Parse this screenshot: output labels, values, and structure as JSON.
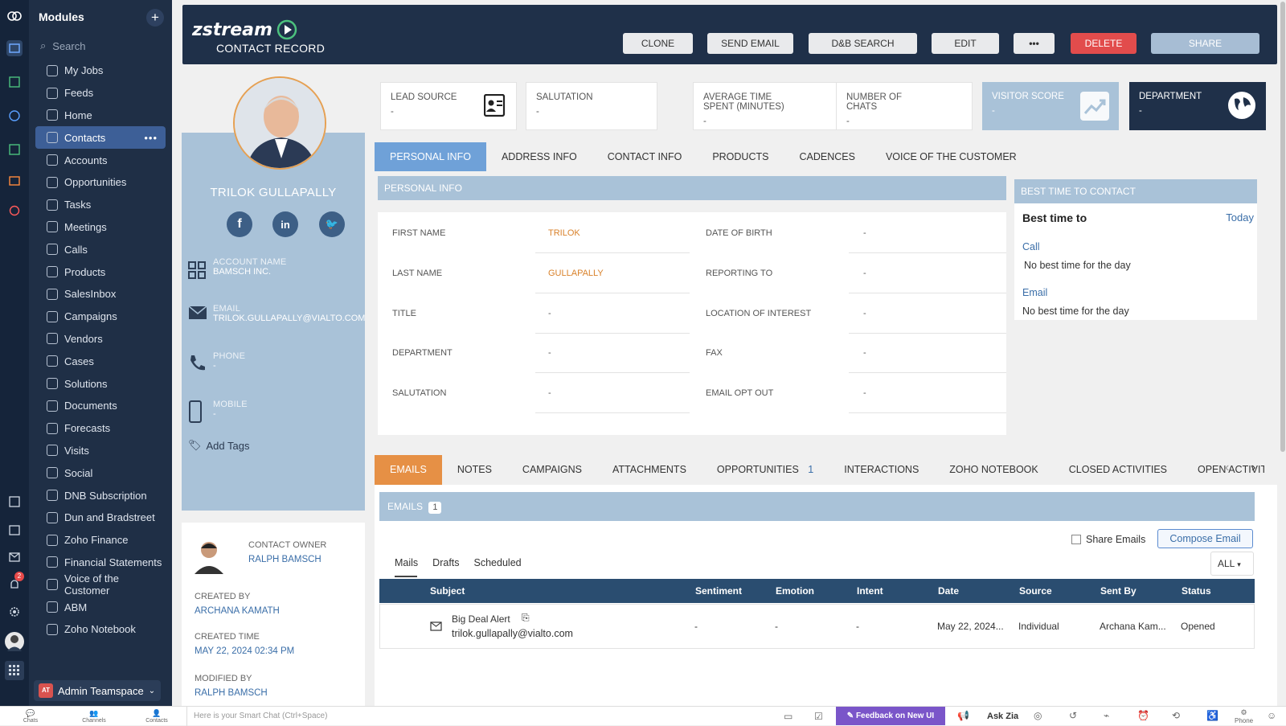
{
  "sidebar": {
    "title": "Modules",
    "add": "+",
    "search_placeholder": "Search",
    "items": [
      "My Jobs",
      "Feeds",
      "Home",
      "Contacts",
      "Accounts",
      "Opportunities",
      "Tasks",
      "Meetings",
      "Calls",
      "Products",
      "SalesInbox",
      "Campaigns",
      "Vendors",
      "Cases",
      "Solutions",
      "Documents",
      "Forecasts",
      "Visits",
      "Social",
      "DNB Subscription",
      "Dun and Bradstreet",
      "Zoho Finance",
      "Financial Statements",
      "Voice of the Customer",
      "ABM",
      "Zoho Notebook"
    ],
    "active": "Contacts",
    "more": "•••",
    "team_initials": "AT",
    "team": "Admin Teamspace",
    "notif_count": "2"
  },
  "header": {
    "logo": "zstream",
    "subtitle": "CONTACT RECORD",
    "buttons": {
      "clone": "CLONE",
      "send_email": "SEND EMAIL",
      "db_search": "D&B SEARCH",
      "edit": "EDIT",
      "more": "•••",
      "delete": "DELETE",
      "share": "SHARE"
    }
  },
  "contact": {
    "name": "TRILOK GULLAPALLY",
    "account_label": "ACCOUNT NAME",
    "account": "BAMSCH INC.",
    "email_label": "EMAIL",
    "email": "TRILOK.GULLAPALLY@VIALTO.COM",
    "phone_label": "PHONE",
    "phone": "-",
    "mobile_label": "MOBILE",
    "mobile": "-",
    "add_tags": "Add Tags",
    "owner_label": "CONTACT OWNER",
    "owner": "RALPH BAMSCH",
    "created_by_label": "CREATED BY",
    "created_by": "ARCHANA KAMATH",
    "created_time_label": "CREATED TIME",
    "created_time": "MAY 22, 2024 02:34 PM",
    "modified_by_label": "MODIFIED BY",
    "modified_by": "RALPH BAMSCH"
  },
  "kpis": [
    {
      "label": "LEAD SOURCE",
      "value": "-"
    },
    {
      "label": "SALUTATION",
      "value": "-"
    },
    {
      "label": "AVERAGE TIME SPENT (MINUTES)",
      "value": "-"
    },
    {
      "label": "NUMBER OF CHATS",
      "value": "-"
    },
    {
      "label": "VISITOR SCORE",
      "value": "-"
    },
    {
      "label": "DEPARTMENT",
      "value": "-"
    }
  ],
  "tabs1": [
    "PERSONAL INFO",
    "ADDRESS INFO",
    "CONTACT INFO",
    "PRODUCTS",
    "CADENCES",
    "VOICE OF THE CUSTOMER"
  ],
  "personal": {
    "section": "PERSONAL INFO",
    "left": [
      [
        "FIRST NAME",
        "TRILOK"
      ],
      [
        "LAST NAME",
        "GULLAPALLY"
      ],
      [
        "TITLE",
        "-"
      ],
      [
        "DEPARTMENT",
        "-"
      ],
      [
        "SALUTATION",
        "-"
      ]
    ],
    "right": [
      [
        "DATE OF BIRTH",
        "-"
      ],
      [
        "REPORTING TO",
        "-"
      ],
      [
        "LOCATION OF INTEREST",
        "-"
      ],
      [
        "FAX",
        "-"
      ],
      [
        "EMAIL OPT OUT",
        "-"
      ]
    ]
  },
  "best_time": {
    "header": "BEST TIME TO CONTACT",
    "title": "Best time to",
    "today": "Today",
    "call": "Call",
    "call_val": "No best time for the day",
    "email": "Email",
    "email_val": "No best time for the day"
  },
  "tabs2": [
    "EMAILS",
    "NOTES",
    "CAMPAIGNS",
    "ATTACHMENTS",
    "OPPORTUNITIES",
    "INTERACTIONS",
    "ZOHO NOTEBOOK",
    "CLOSED ACTIVITIES",
    "OPEN ACTIVIT"
  ],
  "opp_count": "1",
  "emails": {
    "header": "EMAILS",
    "count": "1",
    "share": "Share Emails",
    "compose": "Compose Email",
    "subtabs": [
      "Mails",
      "Drafts",
      "Scheduled"
    ],
    "filter": "ALL",
    "columns": [
      "Subject",
      "Sentiment",
      "Emotion",
      "Intent",
      "Date",
      "Source",
      "Sent By",
      "Status"
    ],
    "row": {
      "subject": "Big Deal Alert",
      "to": "trilok.gullapally@vialto.com",
      "sentiment": "-",
      "emotion": "-",
      "intent": "-",
      "date": "May 22, 2024...",
      "source": "Individual",
      "sent_by": "Archana Kam...",
      "status": "Opened"
    }
  },
  "bottom": {
    "chats": "Chats",
    "channels": "Channels",
    "contacts": "Contacts",
    "smart_chat": "Here is your Smart Chat (Ctrl+Space)",
    "feedback": "Feedback on New UI",
    "ask_zia": "Ask Zia",
    "phone": "Phone"
  },
  "colors": {
    "header": "#1f3049",
    "accent": "#6fa1d8",
    "orange": "#e69045",
    "delete": "#d9534f"
  }
}
